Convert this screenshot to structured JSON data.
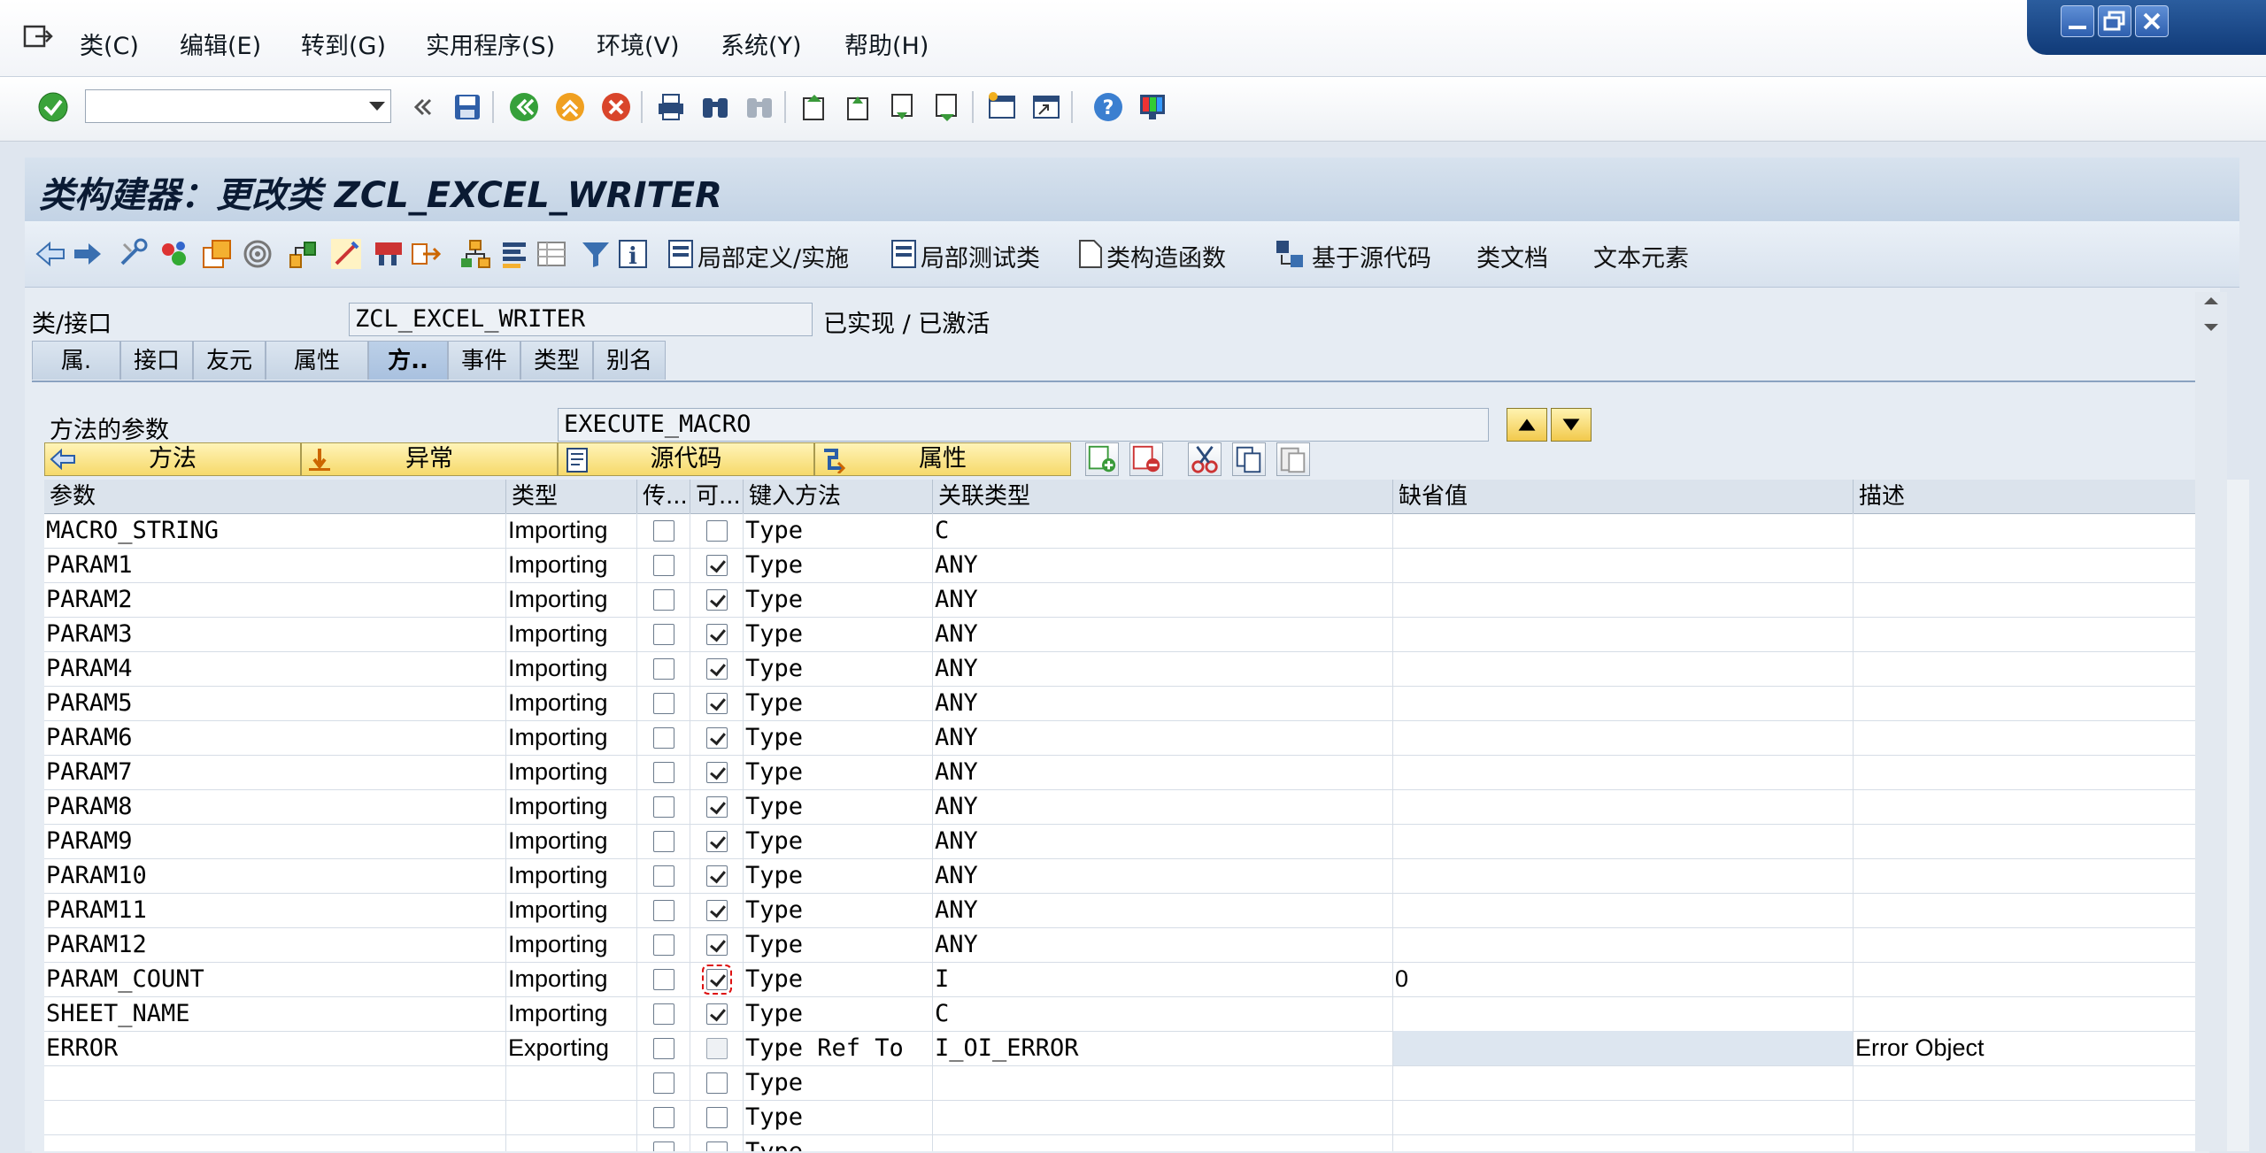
{
  "menu": {
    "items": [
      "类(C)",
      "编辑(E)",
      "转到(G)",
      "实用程序(S)",
      "环境(V)",
      "系统(Y)",
      "帮助(H)"
    ]
  },
  "toolbar": {
    "command_value": "",
    "icons": [
      "enter-icon",
      "back-icon",
      "save-icon",
      "back-green-icon",
      "exit-icon",
      "cancel-icon",
      "print-icon",
      "find-icon",
      "find-next-icon",
      "first-page-icon",
      "prev-page-icon",
      "next-page-icon",
      "last-page-icon",
      "new-session-icon",
      "shortcut-icon",
      "help-icon",
      "layout-icon"
    ]
  },
  "title": "类构建器：更改类 ZCL_EXCEL_WRITER",
  "app_toolbar": {
    "local_def": "局部定义/实施",
    "local_test": "局部测试类",
    "constructor": "类构造函数",
    "source_based": "基于源代码",
    "class_doc": "类文档",
    "text_elements": "文本元素"
  },
  "header": {
    "class_label": "类/接口",
    "class_value": "ZCL_EXCEL_WRITER",
    "status": "已实现 / 已激活"
  },
  "tabs": [
    {
      "label": "属.",
      "active": false
    },
    {
      "label": "接口",
      "active": false
    },
    {
      "label": "友元",
      "active": false
    },
    {
      "label": "属性",
      "active": false
    },
    {
      "label": "方..",
      "active": true
    },
    {
      "label": "事件",
      "active": false
    },
    {
      "label": "类型",
      "active": false
    },
    {
      "label": "别名",
      "active": false
    }
  ],
  "method_params": {
    "label": "方法的参数",
    "method_name": "EXECUTE_MACRO"
  },
  "nav": {
    "methods": "方法",
    "exceptions": "异常",
    "source": "源代码",
    "attributes": "属性"
  },
  "grid": {
    "headers": [
      "参数",
      "类型",
      "传...",
      "可...",
      "键入方法",
      "关联类型",
      "缺省值",
      "描述"
    ],
    "rows": [
      {
        "param": "MACRO_STRING",
        "type": "Importing",
        "pass": false,
        "opt": false,
        "typing": "Type",
        "assoc": "C",
        "default": "",
        "desc": ""
      },
      {
        "param": "PARAM1",
        "type": "Importing",
        "pass": false,
        "opt": true,
        "typing": "Type",
        "assoc": "ANY",
        "default": "",
        "desc": ""
      },
      {
        "param": "PARAM2",
        "type": "Importing",
        "pass": false,
        "opt": true,
        "typing": "Type",
        "assoc": "ANY",
        "default": "",
        "desc": ""
      },
      {
        "param": "PARAM3",
        "type": "Importing",
        "pass": false,
        "opt": true,
        "typing": "Type",
        "assoc": "ANY",
        "default": "",
        "desc": ""
      },
      {
        "param": "PARAM4",
        "type": "Importing",
        "pass": false,
        "opt": true,
        "typing": "Type",
        "assoc": "ANY",
        "default": "",
        "desc": ""
      },
      {
        "param": "PARAM5",
        "type": "Importing",
        "pass": false,
        "opt": true,
        "typing": "Type",
        "assoc": "ANY",
        "default": "",
        "desc": ""
      },
      {
        "param": "PARAM6",
        "type": "Importing",
        "pass": false,
        "opt": true,
        "typing": "Type",
        "assoc": "ANY",
        "default": "",
        "desc": ""
      },
      {
        "param": "PARAM7",
        "type": "Importing",
        "pass": false,
        "opt": true,
        "typing": "Type",
        "assoc": "ANY",
        "default": "",
        "desc": ""
      },
      {
        "param": "PARAM8",
        "type": "Importing",
        "pass": false,
        "opt": true,
        "typing": "Type",
        "assoc": "ANY",
        "default": "",
        "desc": ""
      },
      {
        "param": "PARAM9",
        "type": "Importing",
        "pass": false,
        "opt": true,
        "typing": "Type",
        "assoc": "ANY",
        "default": "",
        "desc": ""
      },
      {
        "param": "PARAM10",
        "type": "Importing",
        "pass": false,
        "opt": true,
        "typing": "Type",
        "assoc": "ANY",
        "default": "",
        "desc": ""
      },
      {
        "param": "PARAM11",
        "type": "Importing",
        "pass": false,
        "opt": true,
        "typing": "Type",
        "assoc": "ANY",
        "default": "",
        "desc": ""
      },
      {
        "param": "PARAM12",
        "type": "Importing",
        "pass": false,
        "opt": true,
        "typing": "Type",
        "assoc": "ANY",
        "default": "",
        "desc": ""
      },
      {
        "param": "PARAM_COUNT",
        "type": "Importing",
        "pass": false,
        "opt": true,
        "typing": "Type",
        "assoc": "I",
        "default": "0",
        "desc": "",
        "focus": true
      },
      {
        "param": "SHEET_NAME",
        "type": "Importing",
        "pass": false,
        "opt": true,
        "typing": "Type",
        "assoc": "C",
        "default": "",
        "desc": ""
      },
      {
        "param": "ERROR",
        "type": "Exporting",
        "pass": false,
        "opt": false,
        "typing": "Type Ref To",
        "assoc": "I_OI_ERROR",
        "default": "",
        "desc": "Error Object",
        "disabled_opt": true
      },
      {
        "param": "",
        "type": "",
        "pass": false,
        "opt": false,
        "typing": "Type",
        "assoc": "",
        "default": "",
        "desc": ""
      },
      {
        "param": "",
        "type": "",
        "pass": false,
        "opt": false,
        "typing": "Type",
        "assoc": "",
        "default": "",
        "desc": ""
      },
      {
        "param": "",
        "type": "",
        "pass": false,
        "opt": false,
        "typing": "Type",
        "assoc": "",
        "default": "",
        "desc": ""
      }
    ]
  }
}
